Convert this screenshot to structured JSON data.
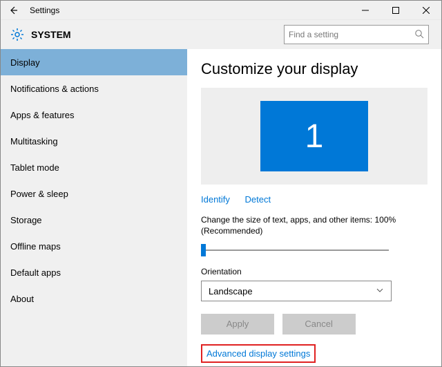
{
  "titlebar": {
    "title": "Settings"
  },
  "header": {
    "section": "SYSTEM",
    "search_placeholder": "Find a setting"
  },
  "sidebar": {
    "items": [
      {
        "label": "Display",
        "active": true
      },
      {
        "label": "Notifications & actions"
      },
      {
        "label": "Apps & features"
      },
      {
        "label": "Multitasking"
      },
      {
        "label": "Tablet mode"
      },
      {
        "label": "Power & sleep"
      },
      {
        "label": "Storage"
      },
      {
        "label": "Offline maps"
      },
      {
        "label": "Default apps"
      },
      {
        "label": "About"
      }
    ]
  },
  "content": {
    "title": "Customize your display",
    "monitor_number": "1",
    "identify_label": "Identify",
    "detect_label": "Detect",
    "scale_label": "Change the size of text, apps, and other items: 100% (Recommended)",
    "orientation_label": "Orientation",
    "orientation_value": "Landscape",
    "apply_label": "Apply",
    "cancel_label": "Cancel",
    "advanced_label": "Advanced display settings"
  }
}
